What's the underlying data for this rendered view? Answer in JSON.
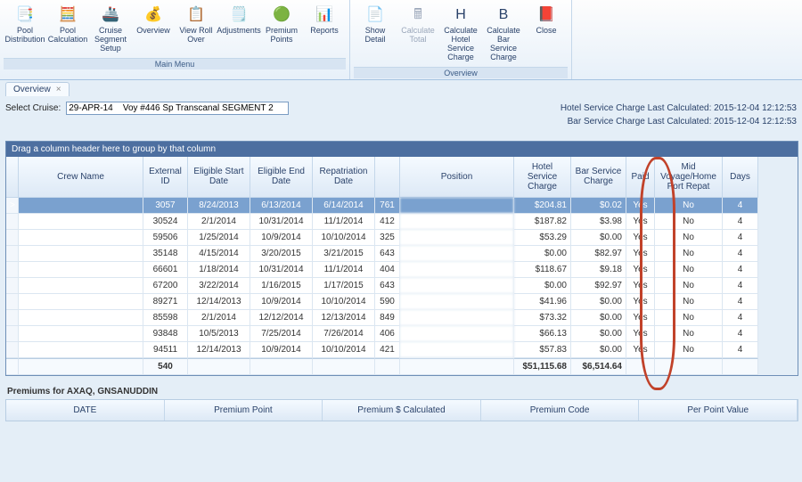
{
  "ribbon": {
    "group_main": {
      "label": "Main Menu",
      "buttons": [
        {
          "icon": "📑",
          "label": "Pool Distribution"
        },
        {
          "icon": "🧮",
          "label": "Pool Calculation"
        },
        {
          "icon": "🚢",
          "label": "Cruise Segment Setup"
        },
        {
          "icon": "💰",
          "label": "Overview"
        },
        {
          "icon": "📋",
          "label": "View Roll Over"
        },
        {
          "icon": "🗒️",
          "label": "Adjustments"
        },
        {
          "icon": "🟢",
          "label": "Premium Points"
        },
        {
          "icon": "📊",
          "label": "Reports"
        }
      ]
    },
    "group_overview": {
      "label": "Overview",
      "buttons": [
        {
          "icon": "📄",
          "label": "Show Detail"
        },
        {
          "icon": "🖩",
          "label": "Calculate Total",
          "disabled": true
        },
        {
          "icon": "H",
          "label": "Calculate Hotel Service Charge"
        },
        {
          "icon": "B",
          "label": "Calculate Bar Service Charge"
        },
        {
          "icon": "📕",
          "label": "Close"
        }
      ]
    }
  },
  "tabs": {
    "active": "Overview",
    "close_glyph": "×"
  },
  "selector": {
    "label": "Select Cruise:",
    "value": "29-APR-14    Voy #446 Sp Transcanal SEGMENT 2",
    "svc_hotel": "Hotel Service Charge Last Calculated: 2015-12-04 12:12:53",
    "svc_bar": "Bar Service Charge Last Calculated: 2015-12-04 12:12:53"
  },
  "grid": {
    "group_prompt": "Drag a column header here to group by that column",
    "columns": [
      "",
      "Crew Name",
      "External ID",
      "Eligible Start Date",
      "Eligible End Date",
      "Repatriation Date",
      "",
      "Position",
      "Hotel Service Charge",
      "Bar Service Charge",
      "Paid",
      "Mid Voyage/Home Port Repat",
      "Days"
    ],
    "rows": [
      {
        "name": " ",
        "ext": "3057",
        "start": "8/24/2013",
        "end": "6/13/2014",
        "rep": "6/14/2014",
        "pcode": "761",
        "pos": " ",
        "hotel": "$204.81",
        "bar": "$0.02",
        "paid": "Yes",
        "mid": "No",
        "days": "4",
        "sel": true
      },
      {
        "name": " ",
        "ext": "30524",
        "start": "2/1/2014",
        "end": "10/31/2014",
        "rep": "11/1/2014",
        "pcode": "412",
        "pos": " ",
        "hotel": "$187.82",
        "bar": "$3.98",
        "paid": "Yes",
        "mid": "No",
        "days": "4"
      },
      {
        "name": " ",
        "ext": "59506",
        "start": "1/25/2014",
        "end": "10/9/2014",
        "rep": "10/10/2014",
        "pcode": "325",
        "pos": " ",
        "hotel": "$53.29",
        "bar": "$0.00",
        "paid": "Yes",
        "mid": "No",
        "days": "4"
      },
      {
        "name": " ",
        "ext": "35148",
        "start": "4/15/2014",
        "end": "3/20/2015",
        "rep": "3/21/2015",
        "pcode": "643",
        "pos": " ",
        "hotel": "$0.00",
        "bar": "$82.97",
        "paid": "Yes",
        "mid": "No",
        "days": "4"
      },
      {
        "name": " ",
        "ext": "66601",
        "start": "1/18/2014",
        "end": "10/31/2014",
        "rep": "11/1/2014",
        "pcode": "404",
        "pos": " ",
        "hotel": "$118.67",
        "bar": "$9.18",
        "paid": "Yes",
        "mid": "No",
        "days": "4"
      },
      {
        "name": " ",
        "ext": "67200",
        "start": "3/22/2014",
        "end": "1/16/2015",
        "rep": "1/17/2015",
        "pcode": "643",
        "pos": " ",
        "hotel": "$0.00",
        "bar": "$92.97",
        "paid": "Yes",
        "mid": "No",
        "days": "4"
      },
      {
        "name": " ",
        "ext": "89271",
        "start": "12/14/2013",
        "end": "10/9/2014",
        "rep": "10/10/2014",
        "pcode": "590",
        "pos": " ",
        "hotel": "$41.96",
        "bar": "$0.00",
        "paid": "Yes",
        "mid": "No",
        "days": "4"
      },
      {
        "name": " ",
        "ext": "85598",
        "start": "2/1/2014",
        "end": "12/12/2014",
        "rep": "12/13/2014",
        "pcode": "849",
        "pos": " ",
        "hotel": "$73.32",
        "bar": "$0.00",
        "paid": "Yes",
        "mid": "No",
        "days": "4"
      },
      {
        "name": " ",
        "ext": "93848",
        "start": "10/5/2013",
        "end": "7/25/2014",
        "rep": "7/26/2014",
        "pcode": "406",
        "pos": " ",
        "hotel": "$66.13",
        "bar": "$0.00",
        "paid": "Yes",
        "mid": "No",
        "days": "4"
      },
      {
        "name": " ",
        "ext": "94511",
        "start": "12/14/2013",
        "end": "10/9/2014",
        "rep": "10/10/2014",
        "pcode": "421",
        "pos": " ",
        "hotel": "$57.83",
        "bar": "$0.00",
        "paid": "Yes",
        "mid": "No",
        "days": "4"
      }
    ],
    "totals": {
      "count": "540",
      "hotel": "$51,115.68",
      "bar": "$6,514.64"
    }
  },
  "premiums": {
    "title": "Premiums for AXAQ, GNSANUDDIN",
    "cols": [
      "DATE",
      "Premium Point",
      "Premium $ Calculated",
      "Premium Code",
      "Per Point Value"
    ]
  }
}
